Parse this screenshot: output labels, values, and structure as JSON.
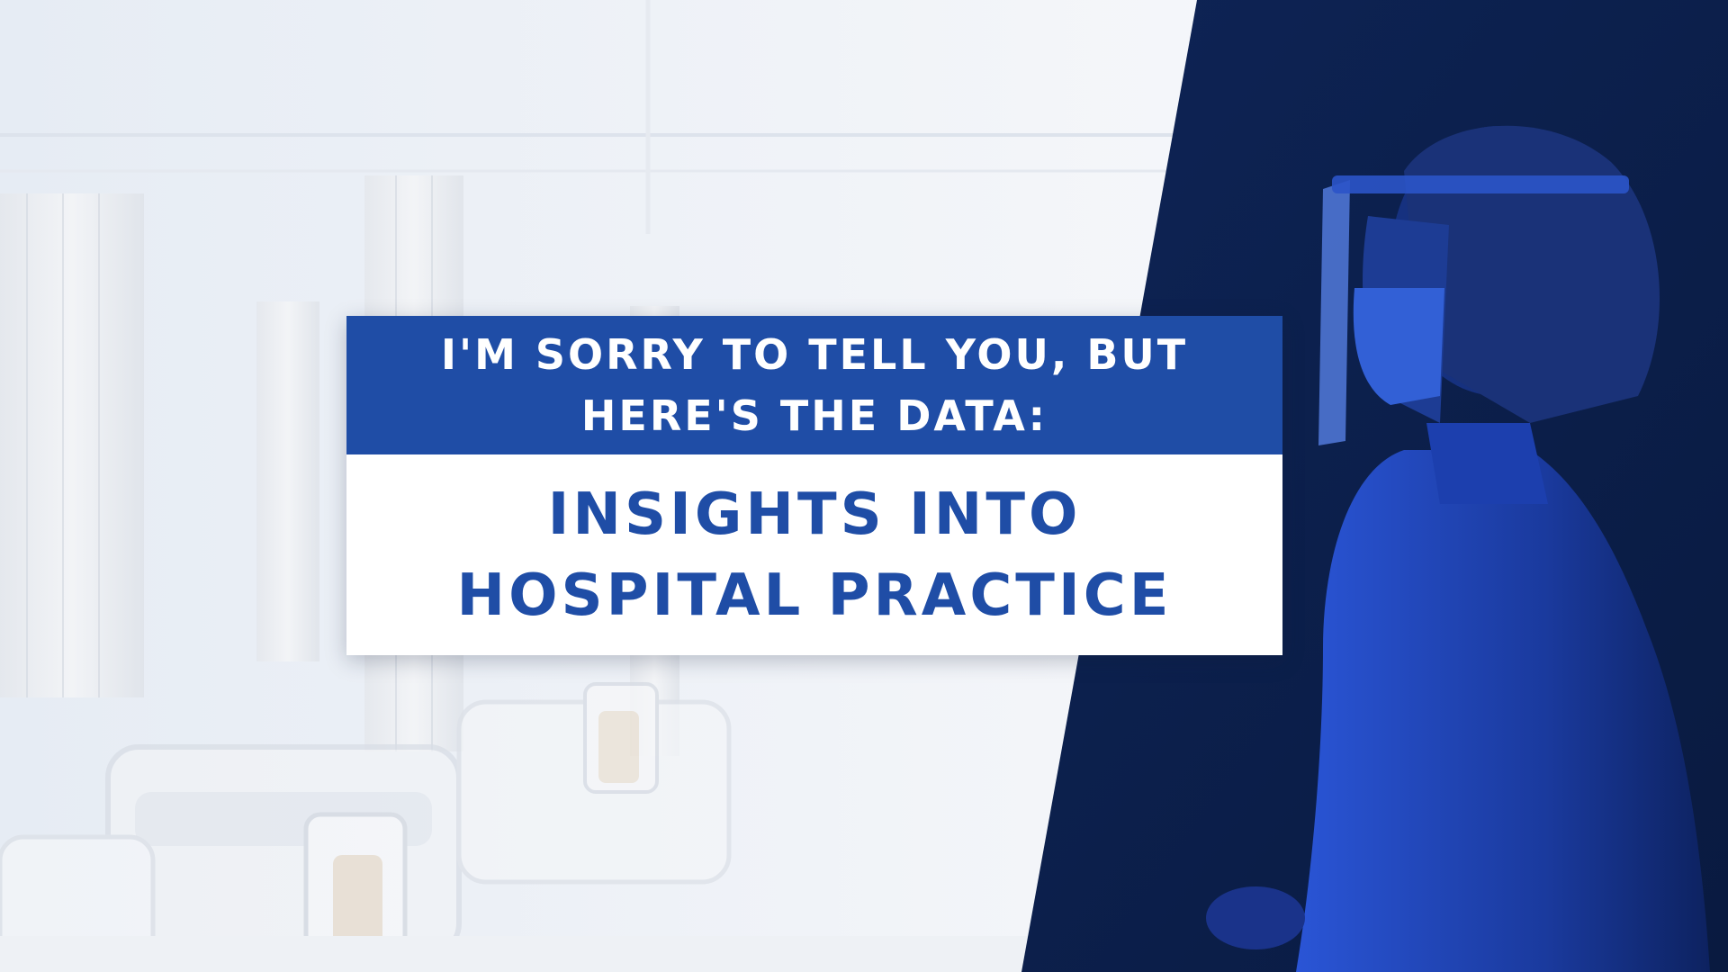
{
  "banner": {
    "kicker_line_1": "I'M SORRY TO TELL YOU, BUT",
    "kicker_line_2": "HERE'S THE DATA:",
    "headline_line_1": "INSIGHTS INTO",
    "headline_line_2": "HOSPITAL PRACTICE"
  },
  "colors": {
    "accent_blue": "#1f4da6",
    "panel_navy": "#0f2350",
    "card_white": "#ffffff",
    "ward_backdrop": "#eef2f7"
  },
  "imagery": {
    "left_photo": "empty-hospital-ward-with-beds-and-curtains",
    "right_photo": "healthcare-worker-with-face-shield-and-mask"
  }
}
